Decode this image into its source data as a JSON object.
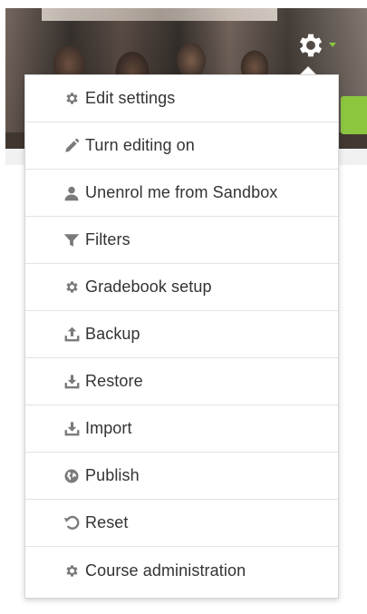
{
  "colors": {
    "icon": "#7a7a7a",
    "text": "#333333",
    "accent_green": "#8cc63f",
    "border": "#d6d6d6"
  },
  "header": {
    "settings_icon": "gear-icon",
    "dropdown_icon": "caret-down-icon"
  },
  "menu": {
    "items": [
      {
        "label": "Edit settings",
        "icon": "gear-icon"
      },
      {
        "label": "Turn editing on",
        "icon": "pencil-icon"
      },
      {
        "label": "Unenrol me from Sandbox",
        "icon": "user-icon"
      },
      {
        "label": "Filters",
        "icon": "filter-icon"
      },
      {
        "label": "Gradebook setup",
        "icon": "gear-icon"
      },
      {
        "label": "Backup",
        "icon": "upload-icon"
      },
      {
        "label": "Restore",
        "icon": "download-icon"
      },
      {
        "label": "Import",
        "icon": "download-icon"
      },
      {
        "label": "Publish",
        "icon": "globe-icon"
      },
      {
        "label": "Reset",
        "icon": "reset-icon"
      },
      {
        "label": "Course administration",
        "icon": "gear-icon"
      }
    ]
  }
}
